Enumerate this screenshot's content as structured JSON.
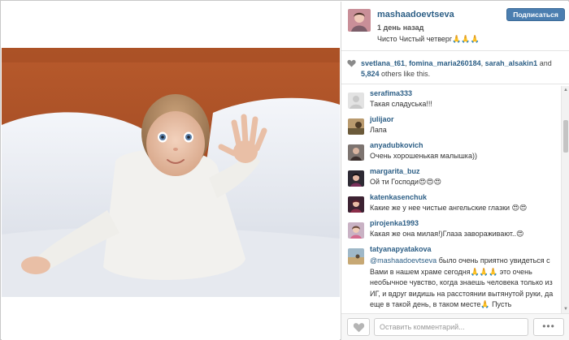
{
  "post": {
    "username": "mashaadoevtseva",
    "time": "1 день назад",
    "caption": "Чисто Чистый четверг🙏🙏🙏",
    "follow_label": "Подписаться"
  },
  "likes": {
    "users": [
      "svetlana_t61",
      "fomina_maria260184",
      "sarah_alsakin1"
    ],
    "and_word": "and",
    "count_text": "5,824",
    "suffix": "others like this."
  },
  "comments": [
    {
      "user": "serafima333",
      "text": "Такая сладуська!!!"
    },
    {
      "user": "julijaor",
      "text": "Лапа"
    },
    {
      "user": "anyadubkovich",
      "text": "Очень хорошенькая малышка))"
    },
    {
      "user": "margarita_buz",
      "text": "Ой ти Господи😍😍😍"
    },
    {
      "user": "katenkasenchuk",
      "text": "Какие же у нее чистые ангельские глазки 😍😍"
    },
    {
      "user": "pirojenka1993",
      "text": "Какая же она милая!)Глаза завораживают..😍"
    },
    {
      "user": "tatyanapyatakova",
      "mention": "@mashaadoevtseva",
      "text": "было очень приятно увидеться с Вами в нашем храме сегодня🙏🙏🙏 это очень необычное чувство, когда знаешь человека только из ИГ, и вдруг видишь на расстоянии вытянутой руки, да еще в такой день, в таком месте🙏 Пусть"
    }
  ],
  "footer": {
    "comment_placeholder": "Оставить комментарий...",
    "more_label": "•••"
  },
  "colors": {
    "link": "#2d5f86",
    "follow_button": "#4b7eb0"
  },
  "icons": {
    "like": "heart-icon",
    "more": "ellipsis-icon"
  }
}
